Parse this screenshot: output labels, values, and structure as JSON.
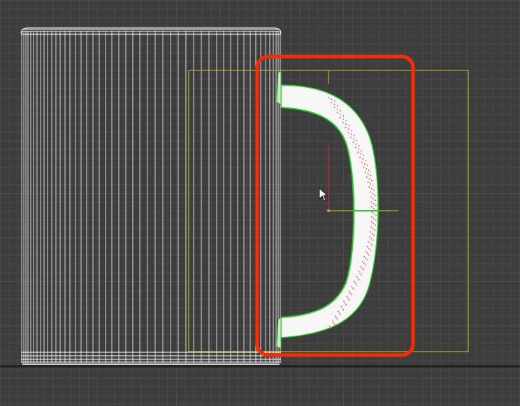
{
  "viewport": {
    "name": "3d-viewport",
    "background_color": "#3d3d3d",
    "grid_color": "#4a4a4a",
    "ground_line_color": "#1e1e1e"
  },
  "scene": {
    "mug_body": {
      "render_mode": "wireframe",
      "color": "#ffffff"
    },
    "mug_handle": {
      "render_mode": "shaded",
      "color": "#ffffff",
      "edge_color": "#22cc22",
      "stipple_color": "#e05050"
    },
    "selection_bounding_box": {
      "color": "#c8c832"
    },
    "gizmo": {
      "axis_x_color": "#e03030",
      "axis_y_color": "#c8c832",
      "axis_z_color": "#22cc22",
      "pivot_color": "#e0a030"
    },
    "highlight_annotation": {
      "color": "#ff2a00",
      "target": "mug handle"
    },
    "cursor": {
      "icon": "arrow-cursor-icon"
    }
  }
}
